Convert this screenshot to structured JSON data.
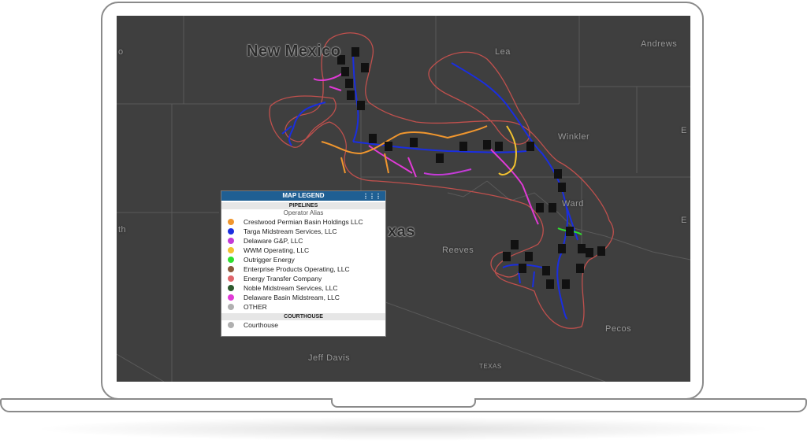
{
  "map": {
    "labels": {
      "new_mexico": "New Mexico",
      "texas": "xas",
      "lea": "Lea",
      "andrews": "Andrews",
      "winkler": "Winkler",
      "ward": "Ward",
      "reeves": "Reeves",
      "pecos": "Pecos",
      "jeff_davis": "Jeff Davis",
      "texas_small": "TEXAS",
      "left_edge_top": "o",
      "left_edge_mid": "th",
      "right_edge_top": "E",
      "right_edge_mid": "E"
    },
    "colors": {
      "background": "#3f3f3f",
      "boundary": "#555555",
      "buffer": "#c0504d",
      "courthouse": "#111111"
    }
  },
  "legend": {
    "title": "MAP LEGEND",
    "grip_icon": "grid-dots-icon",
    "pipelines_header": "PIPELINES",
    "operator_alias": "Operator Alias",
    "items": [
      {
        "label": "Crestwood Permian Basin Holdings LLC",
        "color": "#f0962e"
      },
      {
        "label": "Targa Midstream Services, LLC",
        "color": "#1a2ee0"
      },
      {
        "label": "Delaware G&P, LLC",
        "color": "#c33bd6"
      },
      {
        "label": "WWM Operating, LLC",
        "color": "#f2c230"
      },
      {
        "label": "Outrigger Energy",
        "color": "#2fe02f"
      },
      {
        "label": "Enterprise Products Operating, LLC",
        "color": "#8a5a3c"
      },
      {
        "label": "Energy Transfer Company",
        "color": "#e0646a"
      },
      {
        "label": "Noble Midstream Services, LLC",
        "color": "#2e5a2e"
      },
      {
        "label": "Delaware Basin Midstream, LLC",
        "color": "#e03ad6"
      },
      {
        "label": "OTHER",
        "color": "#b0b0b0"
      }
    ],
    "courthouse_header": "COURTHOUSE",
    "courthouse_item": {
      "label": "Courthouse",
      "color": "#b0b0b0"
    }
  }
}
